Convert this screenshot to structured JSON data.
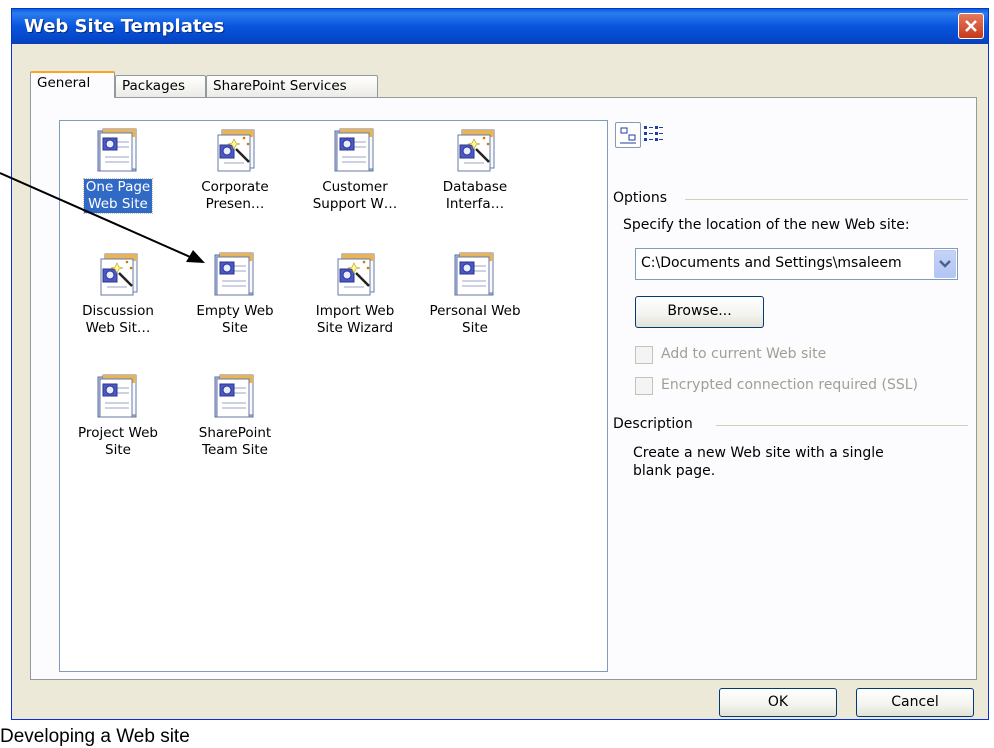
{
  "window": {
    "title": "Web Site Templates"
  },
  "tabs": [
    {
      "label": "General"
    },
    {
      "label": "Packages"
    },
    {
      "label": "SharePoint Services"
    }
  ],
  "templates": [
    {
      "label1": "One Page",
      "label2": "Web Site",
      "icon": "page-icon",
      "selected": true
    },
    {
      "label1": "Corporate",
      "label2": "Presen…",
      "icon": "wizard-icon"
    },
    {
      "label1": "Customer",
      "label2": "Support W…",
      "icon": "page-icon"
    },
    {
      "label1": "Database",
      "label2": "Interfa…",
      "icon": "wizard-icon"
    },
    {
      "label1": "Discussion",
      "label2": "Web Sit…",
      "icon": "wizard-icon"
    },
    {
      "label1": "Empty Web",
      "label2": "Site",
      "icon": "page-icon"
    },
    {
      "label1": "Import Web",
      "label2": "Site Wizard",
      "icon": "wizard-icon"
    },
    {
      "label1": "Personal Web",
      "label2": "Site",
      "icon": "page-icon"
    },
    {
      "label1": "Project Web",
      "label2": "Site",
      "icon": "page-icon"
    },
    {
      "label1": "SharePoint",
      "label2": "Team Site",
      "icon": "page-icon"
    }
  ],
  "options": {
    "heading": "Options",
    "location_label": "Specify the location of the new Web site:",
    "location_value": "C:\\Documents and Settings\\msaleem",
    "browse_label": "Browse...",
    "add_current_label": "Add to current Web site",
    "add_current_checked": false,
    "ssl_label": "Encrypted connection required (SSL)",
    "ssl_checked": false
  },
  "description": {
    "heading": "Description",
    "line1": "Create a new Web site with a single",
    "line2": "blank page."
  },
  "buttons": {
    "ok": "OK",
    "cancel": "Cancel"
  },
  "slide_footer": "Developing a Web site"
}
